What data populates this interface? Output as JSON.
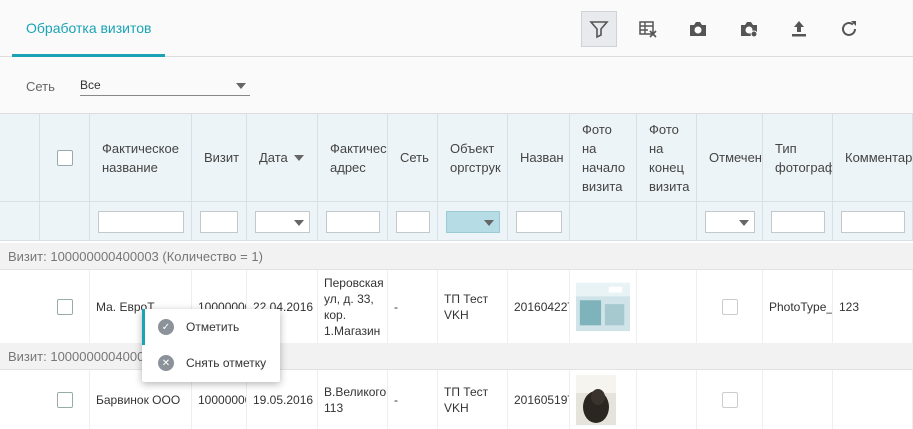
{
  "tabs": {
    "active": "Обработка визитов"
  },
  "toolbar": {
    "icons": [
      "filter-icon",
      "table-clear-icon",
      "camera-icon",
      "camera-search-icon",
      "upload-icon",
      "refresh-icon"
    ]
  },
  "filter": {
    "label": "Сеть",
    "value": "Все"
  },
  "columns": [
    "Фактическое\nназвание",
    "Визит",
    "Дата",
    "Фактичес\nадрес",
    "Сеть",
    "Объект\nоргструк",
    "Назван",
    "Фото\nна\nначало\nвизита",
    "Фото\nна\nконец\nвизита",
    "Отмечен",
    "Тип\nфотограф",
    "Комментар"
  ],
  "groups": [
    {
      "label": "Визит: 100000000400003 (Количество = 1)"
    },
    {
      "label": "Визит: 1000000004000"
    }
  ],
  "rows": [
    {
      "name": "Ма. ЕвроТ",
      "visit": "10000000",
      "date": "22.04.2016",
      "address": "Перовская\nул, д. 33,\nкор.\n1.Магазин",
      "net": "-",
      "org": "ТП Тест\nVKH",
      "title": "20160422T",
      "type": "PhotoType_",
      "comment": "123"
    },
    {
      "name": "Барвинок ООО",
      "visit": "10000000",
      "date": "19.05.2016",
      "address": "В.Великого,\n113",
      "net": "-",
      "org": "ТП Тест\nVKH",
      "title": "20160519T",
      "type": "",
      "comment": ""
    }
  ],
  "menu": {
    "mark": "Отметить",
    "unmark": "Снять отметку"
  },
  "colors": {
    "accent": "#1aa3b5",
    "header_bg": "#edf4f7"
  }
}
